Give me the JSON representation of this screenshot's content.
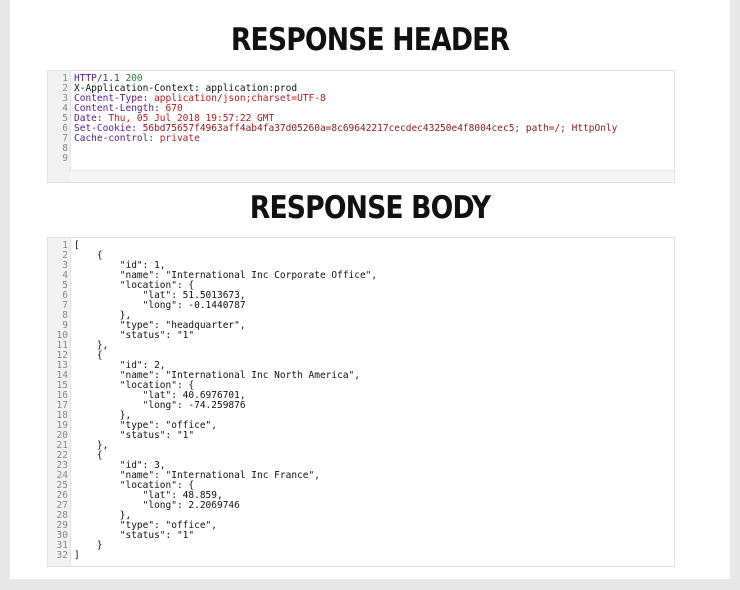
{
  "titles": {
    "response_header": "RESPONSE HEADER",
    "response_body": "RESPONSE BODY"
  },
  "header_lines": [
    {
      "n": "1",
      "parts": [
        {
          "t": "HTTP/1.1 ",
          "c": "purple"
        },
        {
          "t": "200",
          "c": "green"
        }
      ]
    },
    {
      "n": "2",
      "parts": [
        {
          "t": "X-Application-Context: application:prod",
          "c": "black"
        }
      ]
    },
    {
      "n": "3",
      "parts": [
        {
          "t": "Content-Type: ",
          "c": "purple"
        },
        {
          "t": "application/json;charset=UTF-8",
          "c": "red"
        }
      ]
    },
    {
      "n": "4",
      "parts": [
        {
          "t": "Content-Length: ",
          "c": "purple"
        },
        {
          "t": "670",
          "c": "red"
        }
      ]
    },
    {
      "n": "5",
      "parts": [
        {
          "t": "Date: ",
          "c": "purple"
        },
        {
          "t": "Thu, 05 Jul 2018 19:57:22 GMT",
          "c": "red"
        }
      ]
    },
    {
      "n": "6",
      "parts": [
        {
          "t": "Set-Cookie: ",
          "c": "purple"
        },
        {
          "t": "56bd75657f4963aff4ab4fa37d05260a=8c69642217cecdec43250e4f8004cec5; path=/; HttpOnly",
          "c": "maroon"
        }
      ]
    },
    {
      "n": "7",
      "parts": [
        {
          "t": "Cache-control: ",
          "c": "purple"
        },
        {
          "t": "private",
          "c": "red"
        }
      ]
    },
    {
      "n": "8",
      "parts": [
        {
          "t": "",
          "c": "black"
        }
      ]
    },
    {
      "n": "9",
      "parts": [
        {
          "t": "",
          "c": "black"
        }
      ]
    }
  ],
  "body_lines": [
    {
      "n": "1",
      "t": "["
    },
    {
      "n": "2",
      "t": "    {"
    },
    {
      "n": "3",
      "t": "        \"id\": 1,"
    },
    {
      "n": "4",
      "t": "        \"name\": \"International Inc Corporate Office\","
    },
    {
      "n": "5",
      "t": "        \"location\": {"
    },
    {
      "n": "6",
      "t": "            \"lat\": 51.5013673,"
    },
    {
      "n": "7",
      "t": "            \"long\": -0.1440787"
    },
    {
      "n": "8",
      "t": "        },"
    },
    {
      "n": "9",
      "t": "        \"type\": \"headquarter\","
    },
    {
      "n": "10",
      "t": "        \"status\": \"1\""
    },
    {
      "n": "11",
      "t": "    },"
    },
    {
      "n": "12",
      "t": "    {"
    },
    {
      "n": "13",
      "t": "        \"id\": 2,"
    },
    {
      "n": "14",
      "t": "        \"name\": \"International Inc North America\","
    },
    {
      "n": "15",
      "t": "        \"location\": {"
    },
    {
      "n": "16",
      "t": "            \"lat\": 40.6976701,"
    },
    {
      "n": "17",
      "t": "            \"long\": -74.259876"
    },
    {
      "n": "18",
      "t": "        },"
    },
    {
      "n": "19",
      "t": "        \"type\": \"office\","
    },
    {
      "n": "20",
      "t": "        \"status\": \"1\""
    },
    {
      "n": "21",
      "t": "    },"
    },
    {
      "n": "22",
      "t": "    {"
    },
    {
      "n": "23",
      "t": "        \"id\": 3,"
    },
    {
      "n": "24",
      "t": "        \"name\": \"International Inc France\","
    },
    {
      "n": "25",
      "t": "        \"location\": {"
    },
    {
      "n": "26",
      "t": "            \"lat\": 48.859,"
    },
    {
      "n": "27",
      "t": "            \"long\": 2.2069746"
    },
    {
      "n": "28",
      "t": "        },"
    },
    {
      "n": "29",
      "t": "        \"type\": \"office\","
    },
    {
      "n": "30",
      "t": "        \"status\": \"1\""
    },
    {
      "n": "31",
      "t": "    }"
    },
    {
      "n": "32",
      "t": "]"
    }
  ],
  "colors": {
    "purple": "#5a1a8a",
    "green": "#2e7d32",
    "red": "#b71c1c",
    "maroon": "#8b1a1a",
    "black": "#111111"
  }
}
